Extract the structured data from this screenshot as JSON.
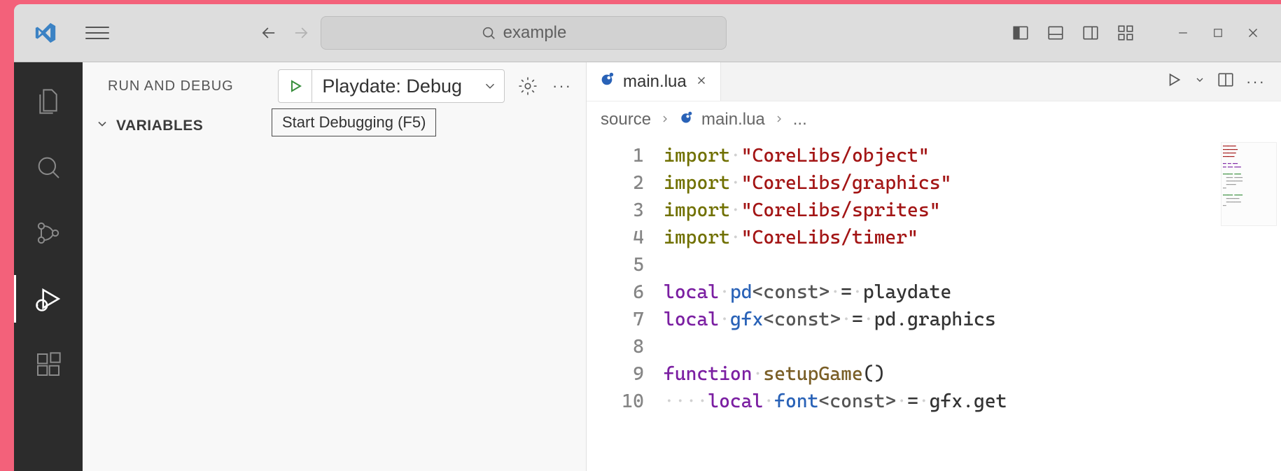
{
  "search": {
    "placeholder": "example"
  },
  "sidepanel": {
    "title": "RUN AND DEBUG",
    "config_label": "Playdate: Debug",
    "section_variables": "VARIABLES"
  },
  "tooltip": {
    "start_debugging": "Start Debugging (F5)"
  },
  "tab": {
    "filename": "main.lua"
  },
  "breadcrumb": {
    "folder": "source",
    "file": "main.lua",
    "more": "..."
  },
  "code": {
    "numbers": [
      "1",
      "2",
      "3",
      "4",
      "5",
      "6",
      "7",
      "8",
      "9",
      "10"
    ],
    "l1": {
      "kw": "import",
      "s": "\"CoreLibs/object\""
    },
    "l2": {
      "kw": "import",
      "s": "\"CoreLibs/graphics\""
    },
    "l3": {
      "kw": "import",
      "s": "\"CoreLibs/sprites\""
    },
    "l4": {
      "kw": "import",
      "s": "\"CoreLibs/timer\""
    },
    "l6": {
      "local": "local",
      "v": "pd",
      "ann": "<const>",
      "eq": "=",
      "rhs": "playdate"
    },
    "l7": {
      "local": "local",
      "v": "gfx",
      "ann": "<const>",
      "eq": "=",
      "rhs": "pd.graphics"
    },
    "l9": {
      "fn": "function",
      "name": "setupGame",
      "paren": "()"
    },
    "l10": {
      "local": "local",
      "v": "font",
      "ann": "<const>",
      "eq": "=",
      "rhs": "gfx.get"
    }
  },
  "colors": {
    "accent_blue": "#2962b7",
    "play_green": "#388e3c",
    "string_red": "#a31515",
    "keyword_purple": "#7b1fa2"
  }
}
